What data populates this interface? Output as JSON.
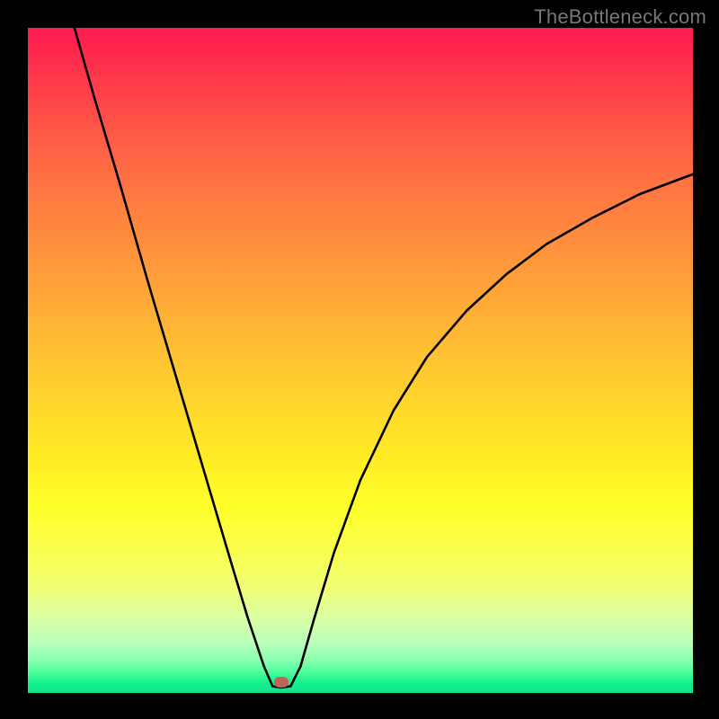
{
  "watermark": "TheBottleneck.com",
  "chart_data": {
    "type": "line",
    "title": "",
    "xlabel": "",
    "ylabel": "",
    "xlim": [
      0,
      100
    ],
    "ylim": [
      0,
      100
    ],
    "grid": false,
    "legend": false,
    "gradient_stops": [
      {
        "pos": 0,
        "color": "#ff1a4e"
      },
      {
        "pos": 8,
        "color": "#ff3a4a"
      },
      {
        "pos": 16,
        "color": "#ff5a46"
      },
      {
        "pos": 24,
        "color": "#ff7542"
      },
      {
        "pos": 32,
        "color": "#ff8e3d"
      },
      {
        "pos": 40,
        "color": "#ffa638"
      },
      {
        "pos": 48,
        "color": "#ffbe33"
      },
      {
        "pos": 56,
        "color": "#ffd52c"
      },
      {
        "pos": 64,
        "color": "#ffea24"
      },
      {
        "pos": 72,
        "color": "#ffff2a"
      },
      {
        "pos": 78,
        "color": "#fbff4a"
      },
      {
        "pos": 84,
        "color": "#f0ff74"
      },
      {
        "pos": 89,
        "color": "#d9ffa6"
      },
      {
        "pos": 92.5,
        "color": "#b8ffba"
      },
      {
        "pos": 95,
        "color": "#8affb0"
      },
      {
        "pos": 97,
        "color": "#48ff9a"
      },
      {
        "pos": 98.5,
        "color": "#12f08e"
      },
      {
        "pos": 100,
        "color": "#0fe28b"
      }
    ],
    "series": [
      {
        "name": "bottleneck-curve",
        "color": "#000000",
        "x": [
          7.0,
          10.0,
          14.0,
          18.0,
          22.0,
          26.0,
          30.0,
          33.0,
          35.5,
          36.8,
          38.0,
          39.5,
          41.0,
          43.0,
          46.0,
          50.0,
          55.0,
          60.0,
          66.0,
          72.0,
          78.0,
          85.0,
          92.0,
          100.0
        ],
        "y": [
          100.0,
          89.5,
          76.0,
          62.0,
          48.5,
          35.0,
          21.5,
          11.5,
          4.0,
          1.0,
          0.8,
          1.0,
          4.0,
          11.0,
          21.0,
          32.0,
          42.5,
          50.5,
          57.5,
          63.0,
          67.5,
          71.5,
          75.0,
          78.0
        ]
      }
    ],
    "marker": {
      "x": 38.0,
      "y": 1.2,
      "color": "#c0645c"
    }
  }
}
